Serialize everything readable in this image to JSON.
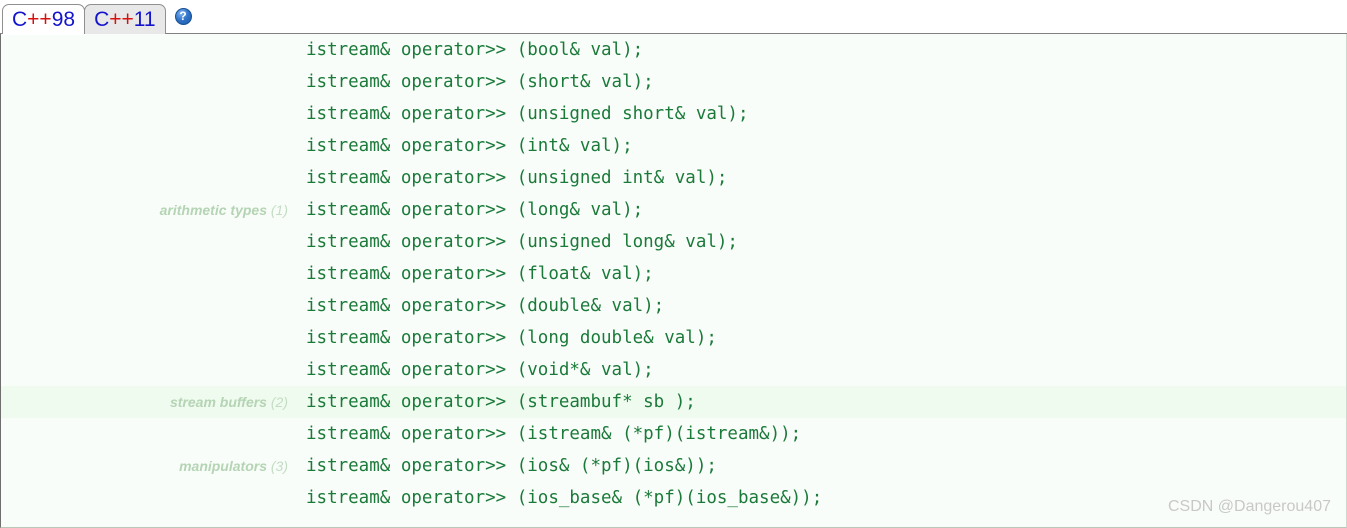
{
  "tabs": [
    {
      "id": "cpp98",
      "label": "C++98",
      "prefix": "C",
      "plus": "++",
      "suffix": "98",
      "active": true
    },
    {
      "id": "cpp11",
      "label": "C++11",
      "prefix": "C",
      "plus": "++",
      "suffix": "11",
      "active": false
    }
  ],
  "help": {
    "icon": "help-circle-icon",
    "glyph": "?"
  },
  "colors": {
    "page_background": "#ffffff",
    "table_background": "#f9fdf9",
    "band_background": "#f0fbf0",
    "code_text": "#1b7a3a",
    "label_text": "#b4d4b4",
    "label_number": "#c3dcc3",
    "tab_text_blue": "#1414cd",
    "tab_text_red": "#d81010",
    "tab_inactive_background": "#e8e8e8",
    "tab_border": "#909090",
    "watermark_text": "#c8c8c8"
  },
  "rows": [
    {
      "label": "",
      "number": "",
      "code": "istream& operator>> (bool& val);",
      "band": false
    },
    {
      "label": "",
      "number": "",
      "code": "istream& operator>> (short& val);",
      "band": false
    },
    {
      "label": "",
      "number": "",
      "code": "istream& operator>> (unsigned short& val);",
      "band": false
    },
    {
      "label": "",
      "number": "",
      "code": "istream& operator>> (int& val);",
      "band": false
    },
    {
      "label": "",
      "number": "",
      "code": "istream& operator>> (unsigned int& val);",
      "band": false
    },
    {
      "label": "arithmetic types",
      "number": "(1)",
      "code": "istream& operator>> (long& val);",
      "band": false
    },
    {
      "label": "",
      "number": "",
      "code": "istream& operator>> (unsigned long& val);",
      "band": false
    },
    {
      "label": "",
      "number": "",
      "code": "istream& operator>> (float& val);",
      "band": false
    },
    {
      "label": "",
      "number": "",
      "code": "istream& operator>> (double& val);",
      "band": false
    },
    {
      "label": "",
      "number": "",
      "code": "istream& operator>> (long double& val);",
      "band": false
    },
    {
      "label": "",
      "number": "",
      "code": "istream& operator>> (void*& val);",
      "band": false
    },
    {
      "label": "stream buffers",
      "number": "(2)",
      "code": "istream& operator>> (streambuf* sb );",
      "band": true
    },
    {
      "label": "",
      "number": "",
      "code": "istream& operator>> (istream& (*pf)(istream&));",
      "band": false
    },
    {
      "label": "manipulators",
      "number": "(3)",
      "code": "istream& operator>> (ios& (*pf)(ios&));",
      "band": false
    },
    {
      "label": "",
      "number": "",
      "code": "istream& operator>> (ios_base& (*pf)(ios_base&));",
      "band": false
    }
  ],
  "watermark": {
    "text": "CSDN @Dangerou407"
  }
}
